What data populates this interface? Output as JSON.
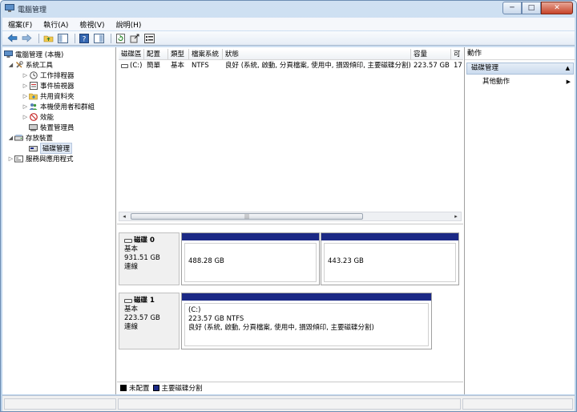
{
  "window": {
    "title": "電腦管理",
    "min_glyph": "─",
    "max_glyph": "□",
    "close_glyph": "✕"
  },
  "menu": [
    "檔案(F)",
    "執行(A)",
    "檢視(V)",
    "說明(H)"
  ],
  "tree": {
    "root": "電腦管理 (本機)",
    "system_tools": "系統工具",
    "task_scheduler": "工作排程器",
    "event_viewer": "事件檢視器",
    "shared_folders": "共用資料夾",
    "local_users": "本機使用者和群組",
    "performance": "效能",
    "device_manager": "裝置管理員",
    "storage": "存放裝置",
    "disk_management": "磁碟管理",
    "services_apps": "服務與應用程式"
  },
  "volume_table": {
    "headers": [
      "磁碟區",
      "配置",
      "類型",
      "檔案系統",
      "狀態",
      "容量",
      "可"
    ],
    "row": [
      "(C:)",
      "簡單",
      "基本",
      "NTFS",
      "良好 (系統, 啟動, 分頁檔案, 使用中, 損毀傾印, 主要磁碟分割)",
      "223.57 GB",
      "17"
    ]
  },
  "scrollbar": {
    "left": "◂",
    "right": "▸",
    "grip": "|||"
  },
  "disks": [
    {
      "name": "磁碟 0",
      "type": "基本",
      "size": "931.51 GB",
      "status": "連線",
      "partitions": [
        {
          "size": "488.28 GB"
        },
        {
          "size": "443.23 GB"
        }
      ]
    },
    {
      "name": "磁碟 1",
      "type": "基本",
      "size": "223.57 GB",
      "status": "連線",
      "partitions": [
        {
          "label": "(C:)",
          "size": "223.57 GB NTFS",
          "status": "良好 (系統, 啟動, 分頁檔案, 使用中, 損毀傾印, 主要磁碟分割)"
        }
      ]
    }
  ],
  "legend": {
    "unallocated": "未配置",
    "primary": "主要磁碟分割",
    "unallocated_color": "#000000",
    "primary_color": "#1b2985"
  },
  "actions": {
    "title": "動作",
    "section": "磁碟管理",
    "more": "其他動作",
    "section_caret": "▲",
    "more_caret": "▶"
  },
  "icons": [
    "back-arrow-icon",
    "forward-arrow-icon",
    "up-folder-icon",
    "show-tree-icon",
    "help-icon",
    "properties-icon",
    "refresh-icon",
    "export-icon",
    "settings-icon"
  ]
}
